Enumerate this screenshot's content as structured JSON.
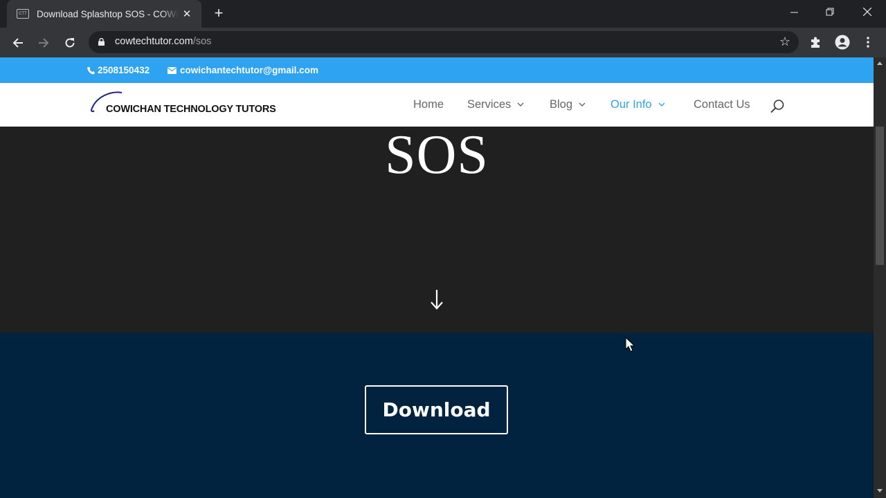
{
  "browser": {
    "tab": {
      "favicon_text": "CTT",
      "title": "Download Splashtop SOS - COWICHAN TECHNOLOGY TUTORS",
      "close_glyph": "✕"
    },
    "new_tab_glyph": "+",
    "window_controls": {
      "minimize": "─",
      "maximize": "❐",
      "close": "✕"
    },
    "address": {
      "domain": "cowtechtutor.com",
      "path": "/sos"
    },
    "star_glyph": "☆"
  },
  "site": {
    "topbar": {
      "phone": "2508150432",
      "email": "cowichantechtutor@gmail.com"
    },
    "logo_text": "COWICHAN TECHNOLOGY TUTORS",
    "nav": [
      {
        "label": "Home",
        "dropdown": false
      },
      {
        "label": "Services",
        "dropdown": true
      },
      {
        "label": "Blog",
        "dropdown": true
      },
      {
        "label": "Our Info",
        "dropdown": true,
        "active": true
      },
      {
        "label": "Contact Us",
        "dropdown": false
      }
    ],
    "chevron_glyph": "⌄",
    "hero": {
      "title": "SOS"
    },
    "download": {
      "button_label": "Download"
    }
  },
  "colors": {
    "accent": "#2ea3f2",
    "hero_bg": "#202020",
    "download_bg": "#012340"
  }
}
